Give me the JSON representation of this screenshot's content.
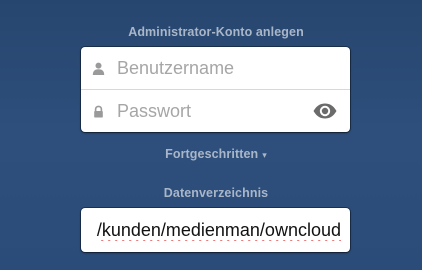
{
  "admin": {
    "heading": "Administrator-Konto anlegen",
    "username_placeholder": "Benutzername",
    "username_icon": "person-icon",
    "password_placeholder": "Passwort",
    "password_icon": "lock-icon",
    "show_password_icon": "eye-icon"
  },
  "advanced": {
    "label": "Fortgeschritten",
    "caret": "▾"
  },
  "data_directory": {
    "heading": "Datenverzeichnis",
    "value": "/kunden/medienman/owncloud"
  }
}
